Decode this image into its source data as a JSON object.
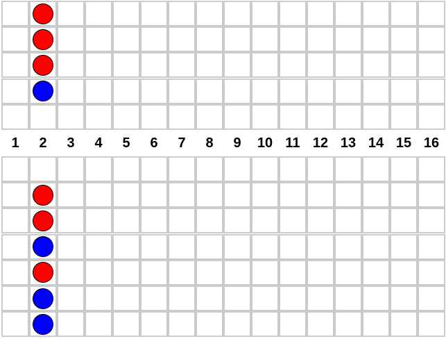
{
  "columns": [
    "1",
    "2",
    "3",
    "4",
    "5",
    "6",
    "7",
    "8",
    "9",
    "10",
    "11",
    "12",
    "13",
    "14",
    "15",
    "16"
  ],
  "colors": {
    "red": "#ff0000",
    "blue": "#0000ff",
    "grid_line": "#cbcbcb"
  },
  "top_stack": {
    "column": "2",
    "pieces_from_top": [
      "red",
      "red",
      "red",
      "blue"
    ]
  },
  "bottom_stack": {
    "column": "2",
    "pieces_from_top": [
      "red",
      "red",
      "blue",
      "red",
      "blue",
      "blue"
    ]
  }
}
